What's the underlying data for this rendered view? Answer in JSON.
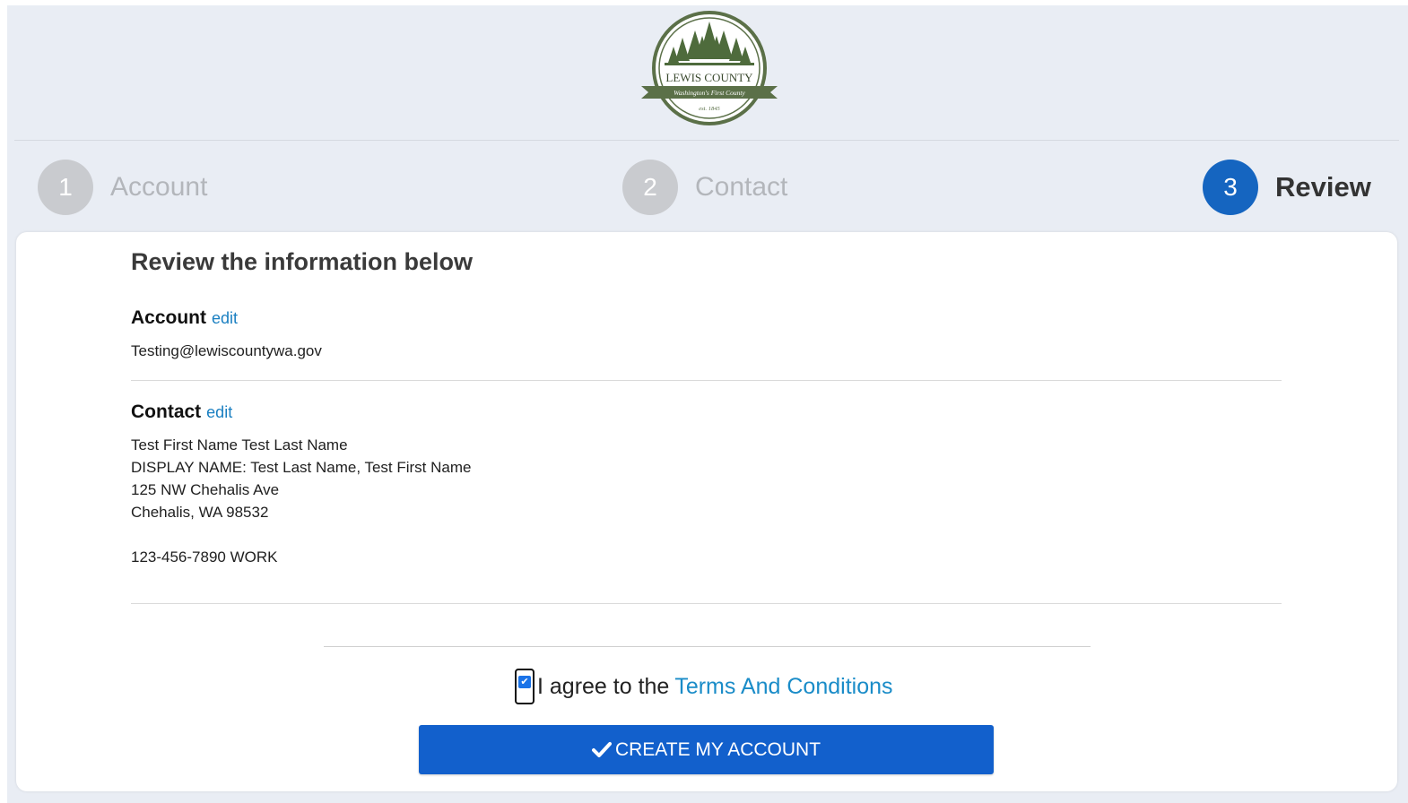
{
  "logo": {
    "text": "LEWIS COUNTY",
    "tagline": "Washington's First County",
    "est": "est. 1845",
    "color": "#5b7048"
  },
  "steps": [
    {
      "number": "1",
      "label": "Account",
      "state": "inactive"
    },
    {
      "number": "2",
      "label": "Contact",
      "state": "inactive"
    },
    {
      "number": "3",
      "label": "Review",
      "state": "active"
    }
  ],
  "review": {
    "title": "Review the information below",
    "account": {
      "heading": "Account",
      "edit_label": "edit",
      "email": "Testing@lewiscountywa.gov"
    },
    "contact": {
      "heading": "Contact",
      "edit_label": "edit",
      "name": "Test First Name Test Last Name",
      "display_name": "DISPLAY NAME: Test Last Name, Test First Name",
      "address_line1": "125 NW Chehalis Ave",
      "address_line2": "Chehalis, WA 98532",
      "phone": "123-456-7890 WORK"
    }
  },
  "agreement": {
    "checked": true,
    "text": "I agree to the",
    "link_text": "Terms And Conditions"
  },
  "create_button": {
    "label": "CREATE MY ACCOUNT",
    "icon": "check-icon"
  },
  "colors": {
    "active_step": "#1565c0",
    "inactive_step": "#c9cbcf",
    "link": "#1a7fc1",
    "button": "#1260cc",
    "background": "#e9edf4"
  }
}
